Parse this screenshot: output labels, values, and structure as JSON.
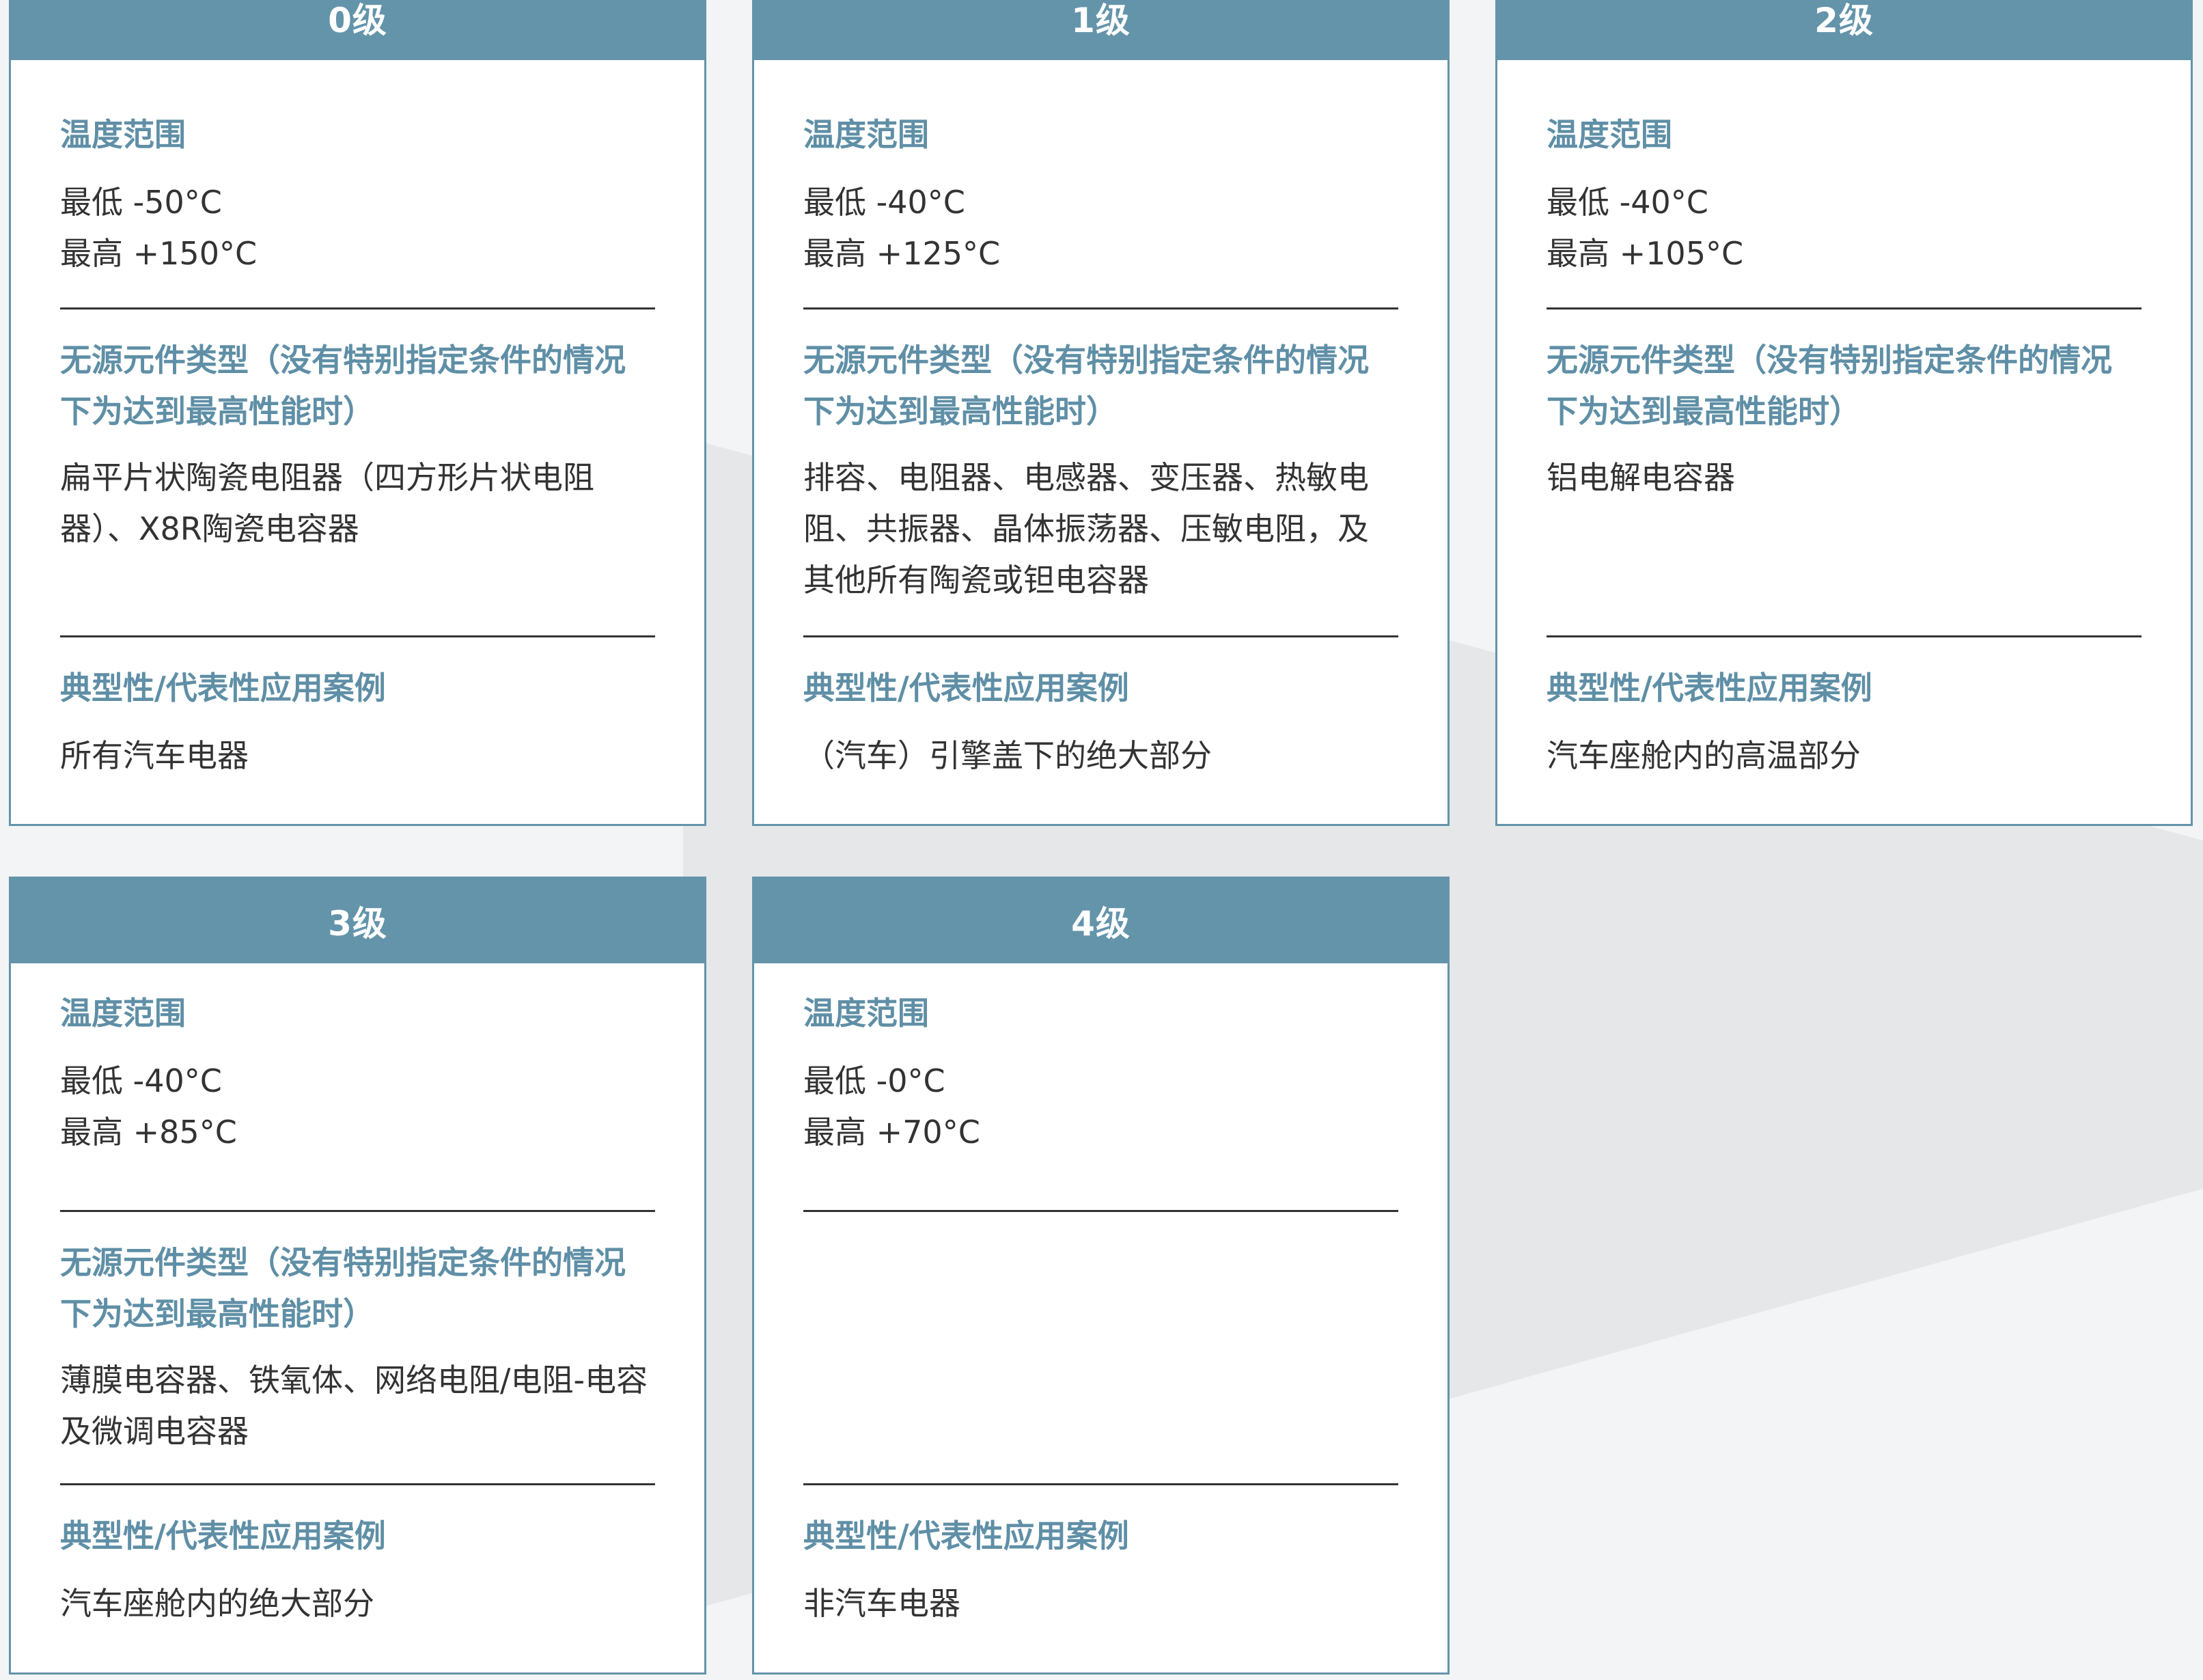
{
  "grades": [
    {
      "header": "0级",
      "temp_title": "温度范围",
      "temp_min": "最低 -50°C",
      "temp_max": "最高 +150°C",
      "passive_title": "无源元件类型（没有特别指定条件的情况下为达到最高性能时）",
      "passive_text": "扁平片状陶瓷电阻器（四方形片状电阻器）、X8R陶瓷电容器",
      "case_title": "典型性/代表性应用案例",
      "case_text": "所有汽车电器"
    },
    {
      "header": "1级",
      "temp_title": "温度范围",
      "temp_min": "最低 -40°C",
      "temp_max": "最高 +125°C",
      "passive_title": "无源元件类型（没有特别指定条件的情况下为达到最高性能时）",
      "passive_text": "排容、电阻器、电感器、变压器、热敏电阻、共振器、晶体振荡器、压敏电阻，及其他所有陶瓷或钽电容器",
      "case_title": "典型性/代表性应用案例",
      "case_text": "（汽车）引擎盖下的绝大部分"
    },
    {
      "header": "2级",
      "temp_title": "温度范围",
      "temp_min": "最低 -40°C",
      "temp_max": "最高 +105°C",
      "passive_title": "无源元件类型（没有特别指定条件的情况下为达到最高性能时）",
      "passive_text": "铝电解电容器",
      "case_title": "典型性/代表性应用案例",
      "case_text": "汽车座舱内的高温部分"
    },
    {
      "header": "3级",
      "temp_title": "温度范围",
      "temp_min": "最低 -40°C",
      "temp_max": "最高 +85°C",
      "passive_title": "无源元件类型（没有特别指定条件的情况下为达到最高性能时）",
      "passive_text": "薄膜电容器、铁氧体、网络电阻/电阻-电容及微调电容器",
      "case_title": "典型性/代表性应用案例",
      "case_text": "汽车座舱内的绝大部分"
    },
    {
      "header": "4级",
      "temp_title": "温度范围",
      "temp_min": "最低 -0°C",
      "temp_max": "最高 +70°C",
      "passive_title": "",
      "passive_text": "",
      "case_title": "典型性/代表性应用案例",
      "case_text": "非汽车电器"
    }
  ],
  "colors": {
    "header_bg": "#6494aa",
    "section_title": "#5f8fa6",
    "body_text": "#333333"
  }
}
